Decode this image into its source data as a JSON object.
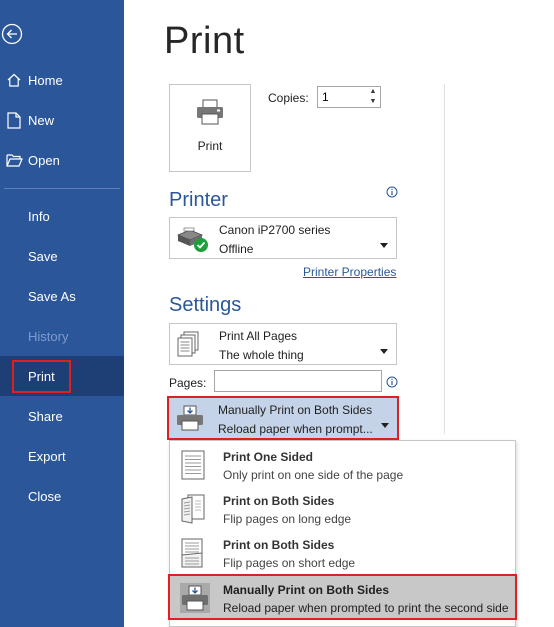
{
  "sidebar": {
    "items": [
      {
        "label": "Home"
      },
      {
        "label": "New"
      },
      {
        "label": "Open"
      },
      {
        "label": "Info"
      },
      {
        "label": "Save"
      },
      {
        "label": "Save As"
      },
      {
        "label": "History"
      },
      {
        "label": "Print"
      },
      {
        "label": "Share"
      },
      {
        "label": "Export"
      },
      {
        "label": "Close"
      }
    ],
    "icons": {
      "back": "back-arrow-icon",
      "home": "home-icon",
      "new": "new-document-icon",
      "open": "open-folder-icon"
    }
  },
  "page": {
    "title": "Print"
  },
  "print_button": {
    "label": "Print",
    "icon": "printer-icon"
  },
  "copies": {
    "label": "Copies:",
    "value": "1"
  },
  "printer": {
    "section_title": "Printer",
    "name": "Canon iP2700 series",
    "status": "Offline",
    "properties_link": "Printer Properties",
    "icon": "printer-ready-icon"
  },
  "settings": {
    "section_title": "Settings",
    "pages_dropdown": {
      "title": "Print All Pages",
      "subtitle": "The whole thing",
      "icon": "pages-icon"
    },
    "pages_label": "Pages:",
    "pages_value": "",
    "sides_dropdown": {
      "title": "Manually Print on Both Sides",
      "subtitle": "Reload paper when prompt...",
      "icon": "manual-duplex-icon"
    }
  },
  "flyout": {
    "items": [
      {
        "title": "Print One Sided",
        "subtitle": "Only print on one side of the page",
        "icon": "one-sided-icon"
      },
      {
        "title": "Print on Both Sides",
        "subtitle": "Flip pages on long edge",
        "icon": "long-edge-flip-icon"
      },
      {
        "title": "Print on Both Sides",
        "subtitle": "Flip pages on short edge",
        "icon": "short-edge-flip-icon"
      },
      {
        "title": "Manually Print on Both Sides",
        "subtitle": "Reload paper when prompted to print the second side",
        "icon": "manual-duplex-icon"
      }
    ]
  },
  "colors": {
    "sidebar": "#2b579a",
    "sidebar_selected": "#1e3f76",
    "accent": "#2b579a",
    "highlight_border": "#e02020",
    "selected_fill": "#c5d3e8"
  }
}
